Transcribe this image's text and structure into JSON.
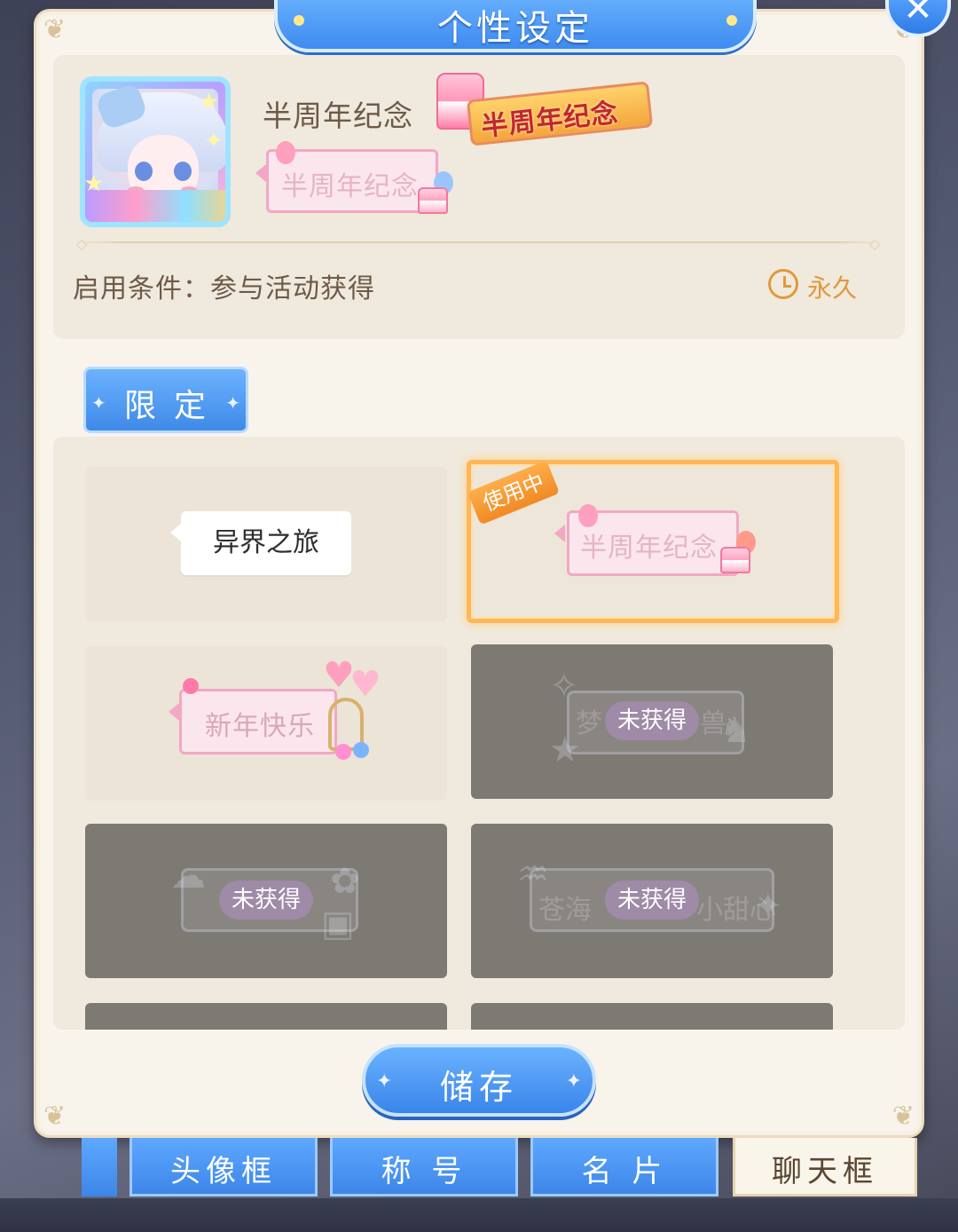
{
  "window": {
    "title": "个性设定",
    "close_icon": "close-icon"
  },
  "preview": {
    "item_name": "半周年纪念",
    "badge_text": "半周年纪念",
    "bubble_text": "半周年纪念",
    "condition_text": "启用条件：参与活动获得",
    "duration_text": "永久",
    "duration_icon": "clock-icon"
  },
  "category": {
    "label": "限定"
  },
  "items": [
    {
      "name": "异界之旅",
      "status": "obtained"
    },
    {
      "name": "半周年纪念",
      "status": "in_use",
      "tag": "使用中"
    },
    {
      "name": "新年快乐",
      "status": "obtained"
    },
    {
      "name": "梦",
      "name_tail": "兽",
      "status": "locked",
      "locked_label": "未获得"
    },
    {
      "name": "",
      "status": "locked",
      "locked_label": "未获得"
    },
    {
      "name": "苍海",
      "name_tail": "小甜心",
      "status": "locked",
      "locked_label": "未获得"
    }
  ],
  "actions": {
    "save_label": "储存"
  },
  "bottom_tabs": [
    {
      "label": "头像框",
      "active": false
    },
    {
      "label": "称 号",
      "active": false
    },
    {
      "label": "名 片",
      "active": false
    },
    {
      "label": "聊天框",
      "active": true
    }
  ],
  "colors": {
    "accent_blue": "#3f8ae8",
    "panel_bg": "#f8f4ec",
    "in_use_orange": "#f08a24",
    "selected_border": "#ffb75a",
    "locked_overlay": "#7d7a73",
    "text_brown": "#6d5a48"
  }
}
